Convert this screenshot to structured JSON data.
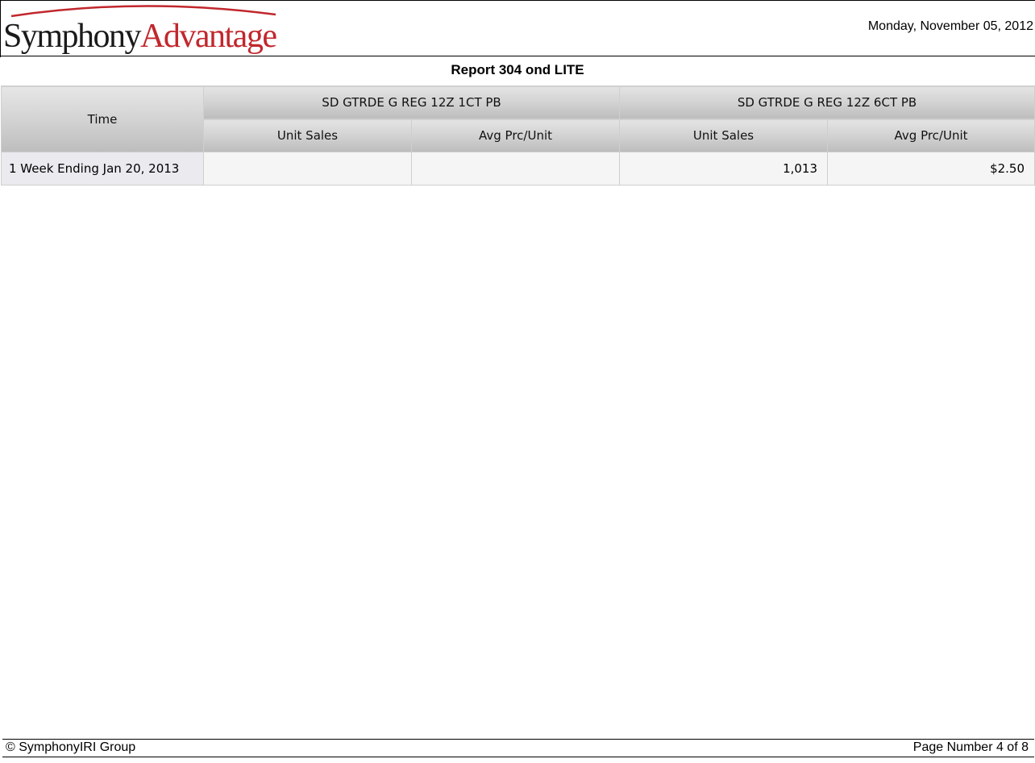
{
  "header": {
    "logo": {
      "part1": "Symphony",
      "part2": "Advantage",
      "colors": {
        "part1": "#1a1a1a",
        "part2": "#c1272d",
        "arc": "#c1272d"
      }
    },
    "date": "Monday, November 05, 2012"
  },
  "report": {
    "title": "Report 304 ond LITE"
  },
  "table": {
    "time_header": "Time",
    "groups": [
      {
        "label": "SD GTRDE G REG 12Z 1CT PB",
        "sub": [
          "Unit Sales",
          "Avg Prc/Unit"
        ]
      },
      {
        "label": "SD GTRDE G REG 12Z 6CT PB",
        "sub": [
          "Unit Sales",
          "Avg Prc/Unit"
        ]
      }
    ],
    "rows": [
      {
        "time": "1 Week Ending Jan 20, 2013",
        "cells": [
          "",
          "",
          "1,013",
          "$2.50"
        ]
      }
    ]
  },
  "footer": {
    "copyright": "© SymphonyIRI Group",
    "page": "Page Number 4 of 8"
  }
}
